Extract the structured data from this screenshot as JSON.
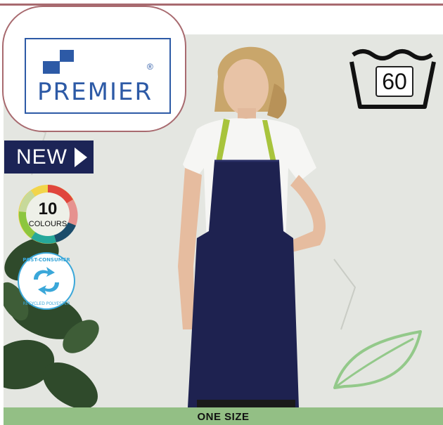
{
  "brand": {
    "name": "PREMIER",
    "registered_mark": "®",
    "color": "#2d5aa6"
  },
  "care": {
    "wash_temperature": "60",
    "icon": "wash-tub-icon"
  },
  "badges": {
    "new_label": "NEW",
    "colours_count": "10",
    "colours_label": "COLOURS",
    "recycled_text": "POST-CONSUMER RECYCLED POLYESTER",
    "recycled_icon": "recycle-arrows-icon",
    "eco_icon": "leaf-icon"
  },
  "product": {
    "image": "model wearing navy bib apron with lime green neck strap",
    "size_label": "ONE SIZE"
  },
  "colors": {
    "accent_frame": "#a86a6f",
    "new_badge": "#1c2456",
    "size_bar": "#93bf85",
    "apron": "#1e2250",
    "strap": "#a8c43c"
  }
}
